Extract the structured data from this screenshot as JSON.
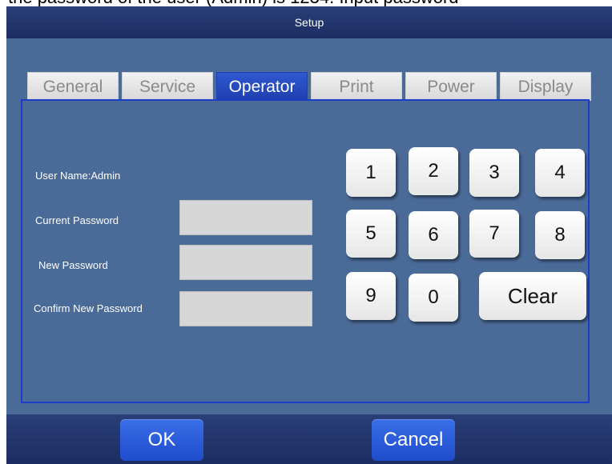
{
  "caption": "the password of the user (Admin) is 1234. Input password",
  "window": {
    "title": "Setup"
  },
  "tabs": [
    {
      "label": "General",
      "active": false
    },
    {
      "label": "Service",
      "active": false
    },
    {
      "label": "Operator",
      "active": true
    },
    {
      "label": "Print",
      "active": false
    },
    {
      "label": "Power",
      "active": false
    },
    {
      "label": "Display",
      "active": false
    }
  ],
  "form": {
    "user_name": "User Name:Admin",
    "current_password_label": "Current Password",
    "new_password_label": "New Password",
    "confirm_password_label": "Confirm New Password",
    "current_password_value": "",
    "new_password_value": "",
    "confirm_password_value": ""
  },
  "keypad": {
    "k1": "1",
    "k2": "2",
    "k3": "3",
    "k4": "4",
    "k5": "5",
    "k6": "6",
    "k7": "7",
    "k8": "8",
    "k9": "9",
    "k0": "0",
    "clear": "Clear"
  },
  "actions": {
    "ok": "OK",
    "cancel": "Cancel"
  },
  "colors": {
    "background": "#4a6a98",
    "bar": "#1c2d62",
    "active_tab": "#2f58d0",
    "panel_border": "#1d3cc8",
    "button": "#1f4ccc"
  }
}
